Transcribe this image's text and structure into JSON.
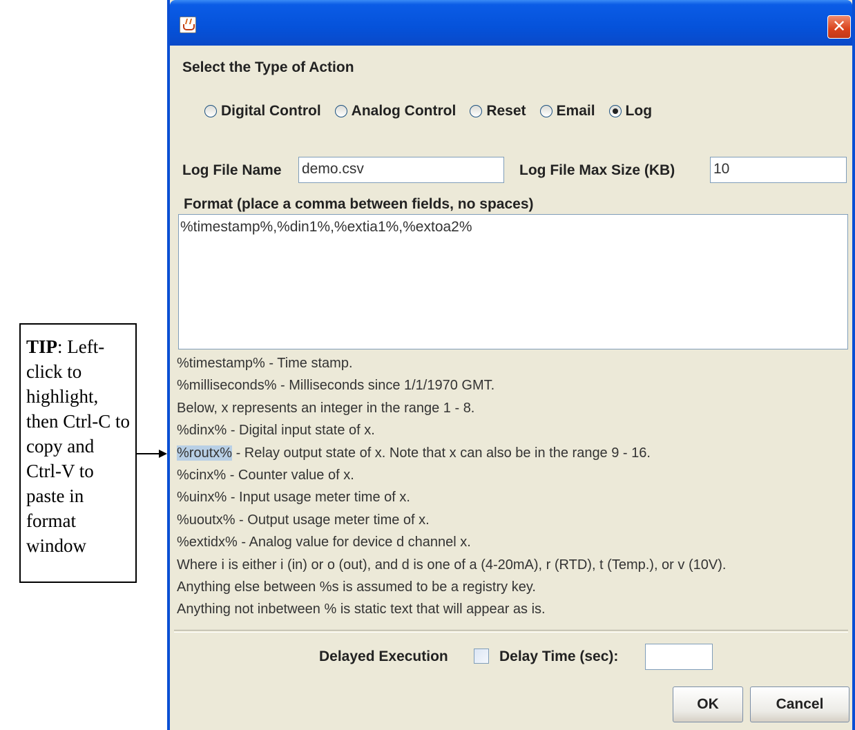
{
  "tip": {
    "bold": "TIP",
    "text": ": Left-click to highlight, then Ctrl-C to copy and Ctrl-V to paste in format window"
  },
  "dialog": {
    "close_glyph": "✕",
    "section_title": "Select the Type of Action",
    "action_types": [
      {
        "label": "Digital Control",
        "selected": false
      },
      {
        "label": "Analog Control",
        "selected": false
      },
      {
        "label": "Reset",
        "selected": false
      },
      {
        "label": "Email",
        "selected": false
      },
      {
        "label": "Log",
        "selected": true
      }
    ],
    "log_file_name_label": "Log File Name",
    "log_file_name_value": "demo.csv",
    "log_file_max_size_label": "Log File Max Size (KB)",
    "log_file_max_size_value": "10",
    "format_label": "Format (place a comma between fields, no spaces)",
    "format_value": "%timestamp%,%din1%,%extia1%,%extoa2%",
    "help_lines": [
      "%timestamp% - Time stamp.",
      "%milliseconds% - Milliseconds since 1/1/1970 GMT.",
      "Below, x represents an integer in the range 1 - 8.",
      "%dinx% - Digital input state of x.",
      {
        "highlight": "%routx%",
        "rest": " - Relay output state of x. Note that x can also be in the range 9 - 16."
      },
      "%cinx% - Counter value of x.",
      "%uinx% - Input usage meter time of x.",
      "%uoutx% - Output usage meter time of x.",
      "%extidx% - Analog value for device d channel x.",
      "Where i is either i (in) or o (out), and d is one of a (4-20mA), r (RTD), t (Temp.), or v (10V).",
      "Anything else between %s is assumed to be a registry key.",
      "Anything not inbetween % is static text that will appear as is."
    ],
    "delayed_execution_label": "Delayed Execution",
    "delayed_execution_checked": false,
    "delay_time_label": "Delay Time (sec):",
    "delay_time_value": "",
    "ok_label": "OK",
    "cancel_label": "Cancel"
  }
}
